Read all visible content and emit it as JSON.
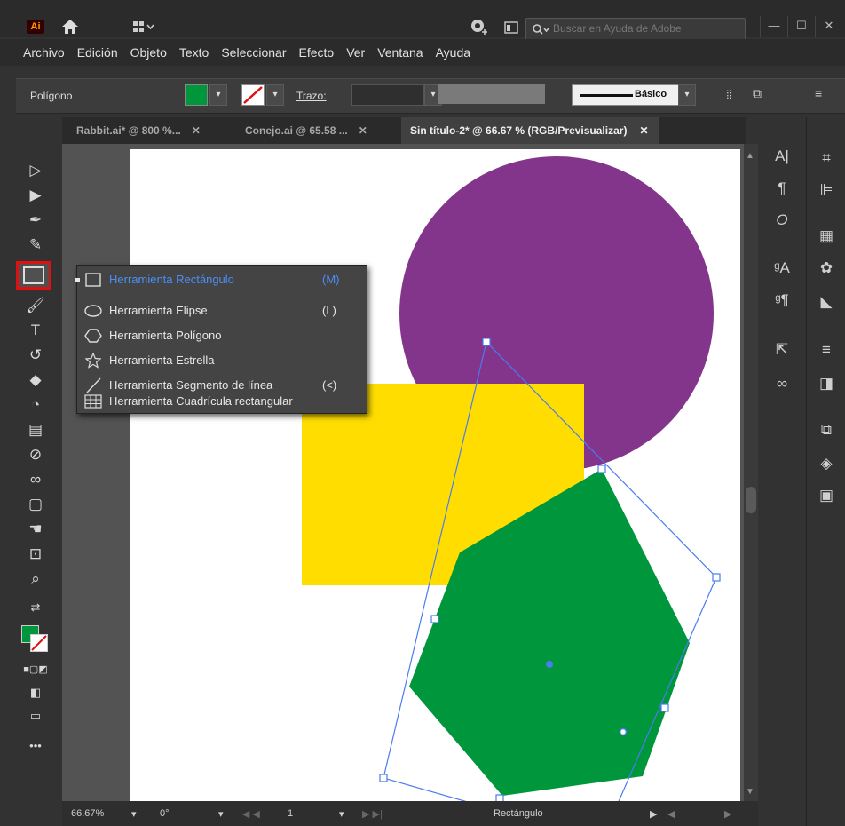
{
  "app": {
    "logo": "Ai"
  },
  "titlebar": {
    "search_placeholder": "Buscar en Ayuda de Adobe",
    "minimize": "—",
    "restore": "☐",
    "close": "✕"
  },
  "menu": [
    "Archivo",
    "Edición",
    "Objeto",
    "Texto",
    "Seleccionar",
    "Efecto",
    "Ver",
    "Ventana",
    "Ayuda"
  ],
  "controlbar": {
    "selection_label": "Polígono",
    "stroke_label": "Trazo:",
    "brush_label": "Básico"
  },
  "tabs": [
    {
      "label": "Rabbit.ai* @ 800 %..."
    },
    {
      "label": "Conejo.ai @ 65.58 ..."
    },
    {
      "label": "Sin título-2* @ 66.67 % (RGB/Previsualizar)"
    }
  ],
  "flyout": [
    {
      "label": "Herramienta Rectángulo",
      "shortcut": "(M)",
      "icon": "rectangle-icon"
    },
    {
      "label": "Herramienta Elipse",
      "shortcut": "(L)",
      "icon": "ellipse-icon"
    },
    {
      "label": "Herramienta Polígono",
      "shortcut": "",
      "icon": "polygon-icon"
    },
    {
      "label": "Herramienta Estrella",
      "shortcut": "",
      "icon": "star-icon"
    },
    {
      "label": "Herramienta Segmento de línea",
      "shortcut": "(<)",
      "icon": "line-segment-icon"
    },
    {
      "label": "Herramienta Cuadrícula rectangular",
      "shortcut": "",
      "icon": "rectangular-grid-icon"
    }
  ],
  "status": {
    "zoom": "66.67%",
    "rotation": "0°",
    "artboard_number": "1",
    "current_tool": "Rectángulo"
  },
  "colors": {
    "fill": "#00963c",
    "circle": "#82358a",
    "rectangle": "#ffdd00",
    "hexagon": "#00963c",
    "selection": "#4a7cf0"
  }
}
